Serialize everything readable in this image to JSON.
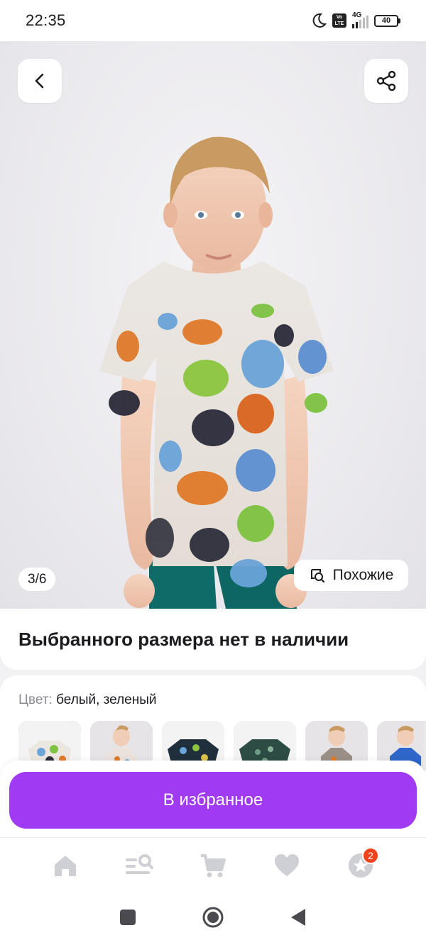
{
  "status_bar": {
    "time": "22:35",
    "network": "4G",
    "volte": "Vo LTE",
    "battery": "40"
  },
  "gallery": {
    "counter": "3/6",
    "similar_label": "Похожие"
  },
  "product": {
    "availability_title": "Выбранного размера нет в наличии"
  },
  "color_selector": {
    "label": "Цвет:",
    "value": "белый, зеленый",
    "swatch_count": 6,
    "selected_index": 0
  },
  "cta": {
    "favorite_label": "В избранное"
  },
  "bottom_nav": {
    "items": [
      "home-icon",
      "catalog-search-icon",
      "cart-icon",
      "heart-icon",
      "star-icon"
    ],
    "badge_count": "2"
  },
  "colors": {
    "accent": "#a13af3",
    "badge": "#f2421b",
    "muted_text": "#8b8b94",
    "nav_icon": "#cfcfd6"
  }
}
